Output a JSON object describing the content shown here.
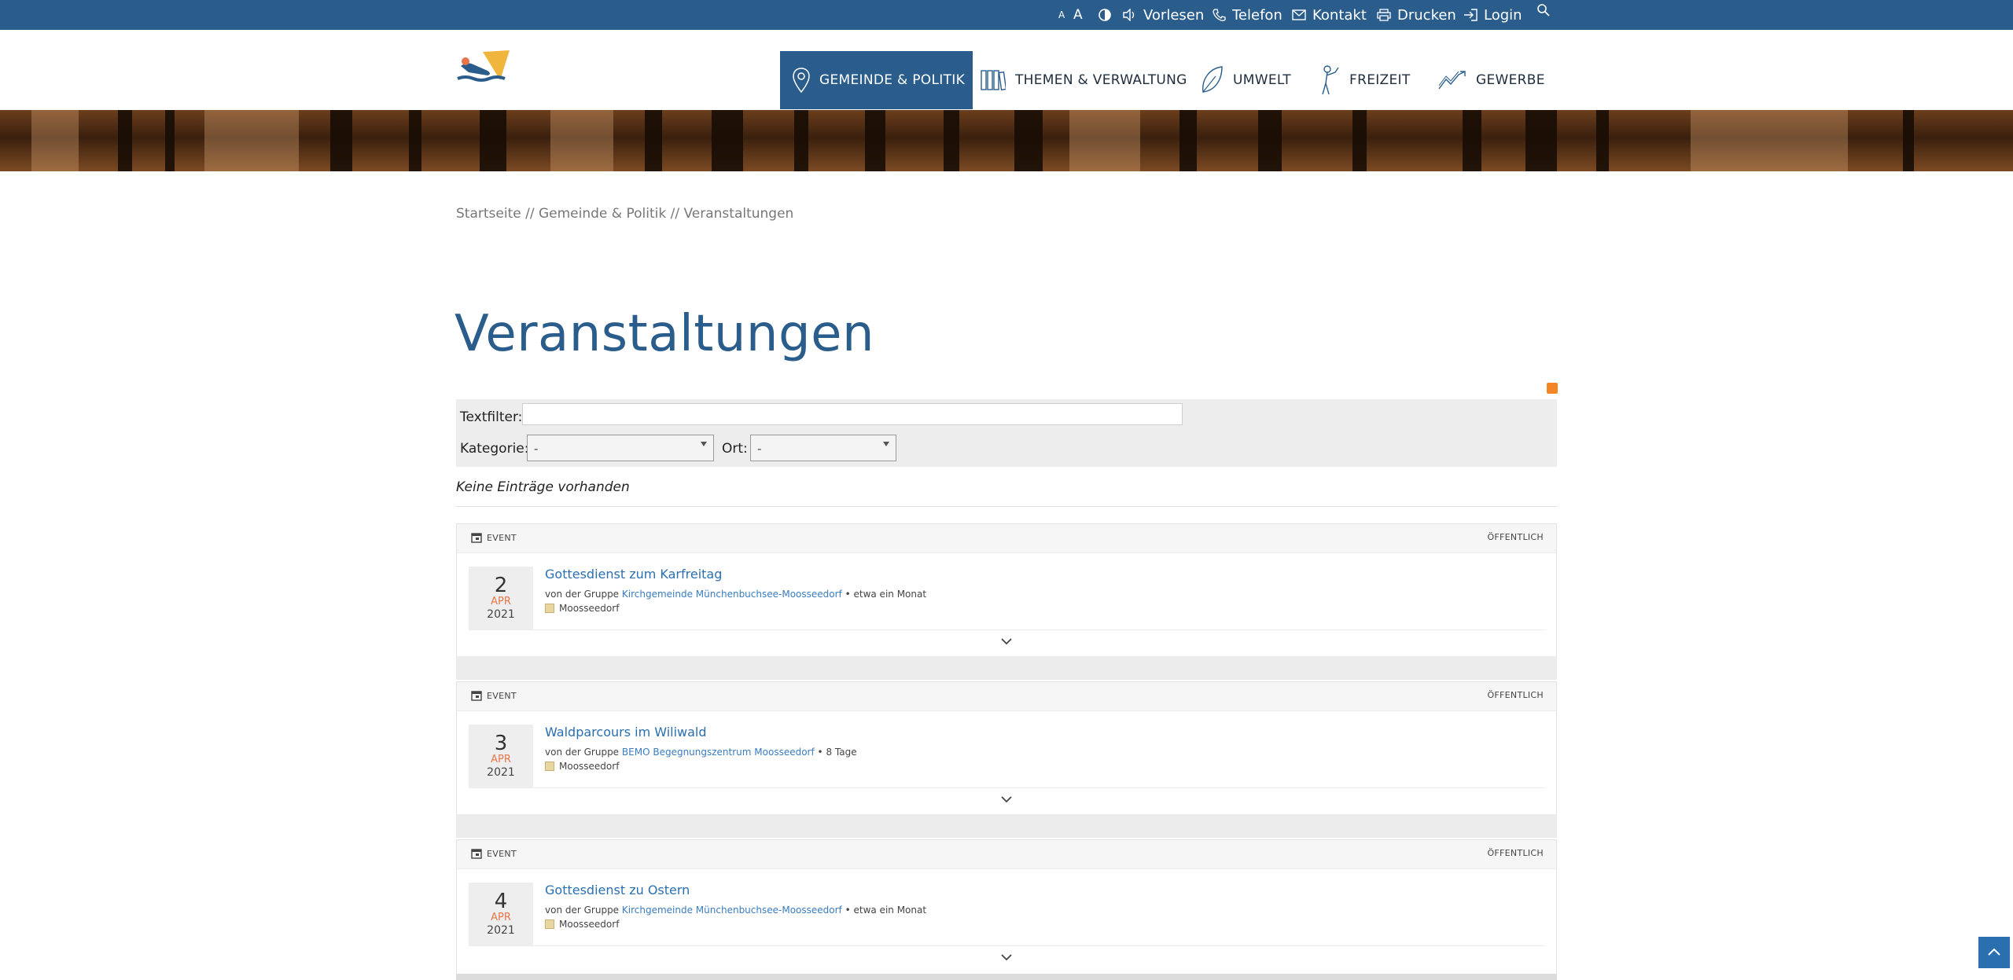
{
  "topbar": {
    "font_small": "A",
    "font_large": "A",
    "vorlesen": "Vorlesen",
    "telefon": "Telefon",
    "kontakt": "Kontakt",
    "drucken": "Drucken",
    "login": "Login",
    "icons": [
      "contrast-icon",
      "speaker-icon",
      "phone-icon",
      "mail-icon",
      "printer-icon",
      "login-icon",
      "search-icon"
    ]
  },
  "nav": {
    "items": [
      {
        "label": "GEMEINDE & POLITIK",
        "icon": "map-pin-icon",
        "active": true
      },
      {
        "label": "THEMEN & VERWALTUNG",
        "icon": "books-icon",
        "active": false
      },
      {
        "label": "UMWELT",
        "icon": "leaf-icon",
        "active": false
      },
      {
        "label": "FREIZEIT",
        "icon": "person-icon",
        "active": false
      },
      {
        "label": "GEWERBE",
        "icon": "chart-trend-icon",
        "active": false
      }
    ]
  },
  "breadcrumb": {
    "home": "Startseite",
    "sep": "//",
    "level1": "Gemeinde & Politik",
    "current": "Veranstaltungen"
  },
  "page": {
    "title": "Veranstaltungen"
  },
  "filter": {
    "text_label": "Textfilter:",
    "text_value": "",
    "category_label": "Kategorie:",
    "category_value": "-",
    "ort_label": "Ort:",
    "ort_value": "-"
  },
  "no_entries": "Keine Einträge vorhanden",
  "events": [
    {
      "type": "EVENT",
      "visibility": "ÖFFENTLICH",
      "day": "2",
      "month": "APR",
      "year": "2021",
      "title": "Gottesdienst zum Karfreitag",
      "by": "von der Gruppe",
      "group": "Kirchgemeinde Münchenbuchsee-Moosseedorf",
      "duration": "• etwa ein Monat",
      "place": "Moosseedorf"
    },
    {
      "type": "EVENT",
      "visibility": "ÖFFENTLICH",
      "day": "3",
      "month": "APR",
      "year": "2021",
      "title": "Waldparcours im Wiliwald",
      "by": "von der Gruppe",
      "group": "BEMO Begegnungszentrum Moosseedorf",
      "duration": "• 8 Tage",
      "place": "Moosseedorf"
    },
    {
      "type": "EVENT",
      "visibility": "ÖFFENTLICH",
      "day": "4",
      "month": "APR",
      "year": "2021",
      "title": "Gottesdienst zu Ostern",
      "by": "von der Gruppe",
      "group": "Kirchgemeinde Münchenbuchsee-Moosseedorf",
      "duration": "• etwa ein Monat",
      "place": "Moosseedorf"
    }
  ],
  "colors": {
    "brand_blue": "#2a5d8c",
    "link_blue": "#2a6fb0",
    "month_orange": "#e8764a"
  }
}
